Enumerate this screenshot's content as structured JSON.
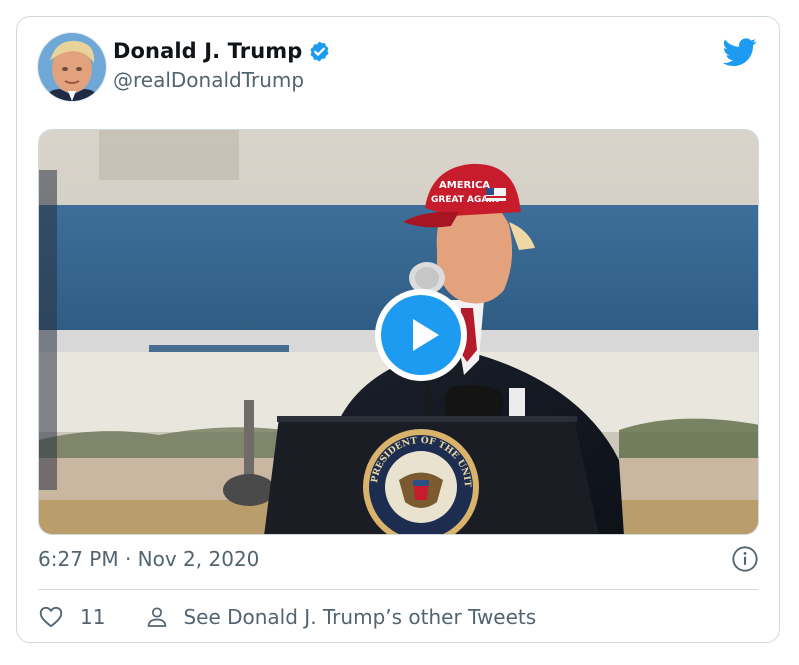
{
  "tweet": {
    "author_name": "Donald J. Trump",
    "handle": "@realDonaldTrump",
    "timestamp": "6:27 PM · Nov 2, 2020",
    "like_count": "11",
    "see_other_tweets": "See Donald J. Trump’s other Tweets",
    "media": {
      "hat_text_line1": "AMERICA",
      "hat_text_line2": "GREAT AGAIN",
      "seal_text": "PRESIDENT OF THE UNITED STATES"
    }
  },
  "icons": {
    "verified": "verified-badge-icon",
    "logo": "twitter-bird-icon",
    "play": "play-icon",
    "info": "info-icon",
    "like": "heart-icon",
    "person": "person-icon"
  },
  "colors": {
    "twitter_blue": "#1d9bf0",
    "secondary_text": "#536471",
    "border": "#cfd9de"
  }
}
